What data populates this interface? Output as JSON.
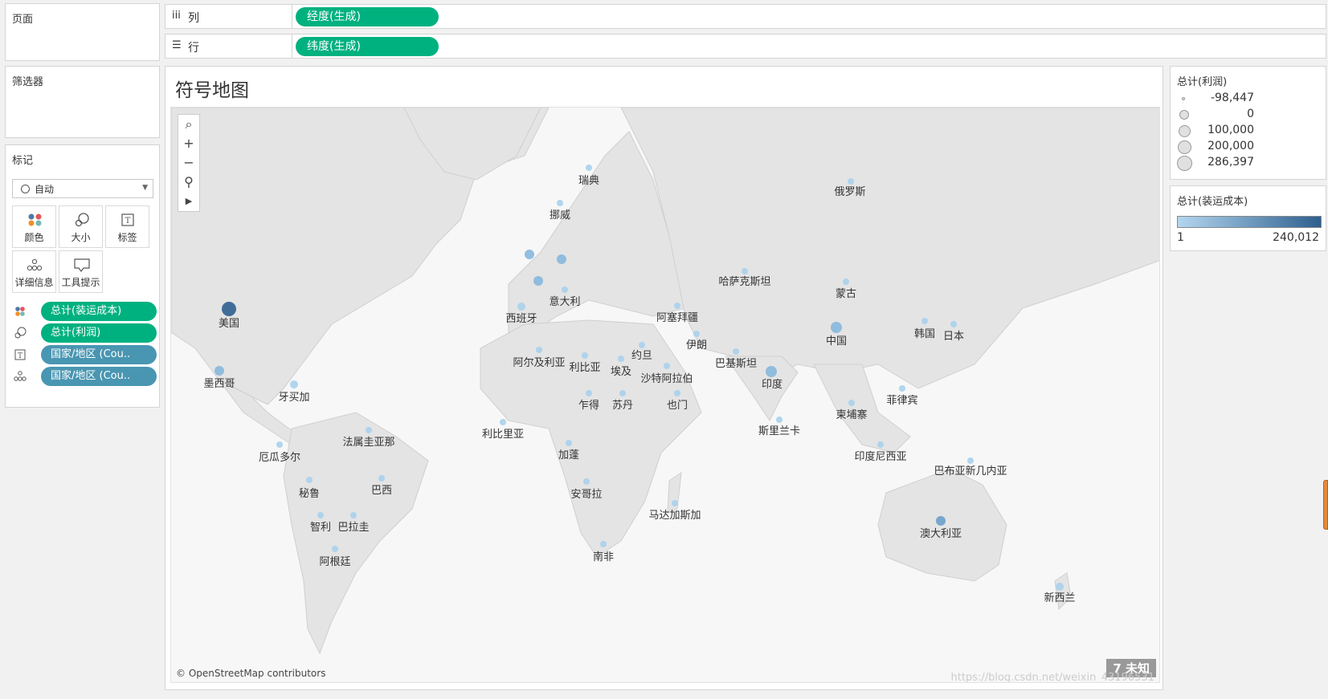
{
  "left": {
    "pages_title": "页面",
    "filters_title": "筛选器",
    "marks_title": "标记",
    "mark_type": "自动",
    "mark_buttons": [
      {
        "label": "颜色",
        "icon": "color-icon"
      },
      {
        "label": "大小",
        "icon": "size-icon"
      },
      {
        "label": "标签",
        "icon": "label-icon"
      },
      {
        "label": "详细信息",
        "icon": "detail-icon"
      },
      {
        "label": "工具提示",
        "icon": "tooltip-icon"
      }
    ],
    "mark_pills": [
      {
        "label": "总计(装运成本)",
        "icon": "color-icon"
      },
      {
        "label": "总计(利润)",
        "icon": "size-icon"
      },
      {
        "label": "国家/地区 (Cou..",
        "icon": "label-icon"
      },
      {
        "label": "国家/地区 (Cou..",
        "icon": "detail-icon"
      }
    ]
  },
  "shelves": {
    "columns_label": "列",
    "columns_pill": "经度(生成)",
    "rows_label": "行",
    "rows_pill": "纬度(生成)"
  },
  "view": {
    "title": "符号地图",
    "attribution": "© OpenStreetMap contributors",
    "unknown_badge": "7 未知",
    "watermark": "https://blog.csdn.net/weixin_43196531"
  },
  "legend_profit": {
    "title": "总计(利润)",
    "items": [
      "-98,447",
      "0",
      "100,000",
      "200,000",
      "286,397"
    ]
  },
  "legend_ship": {
    "title": "总计(装运成本)",
    "min": "1",
    "max": "240,012"
  },
  "map_labels": [
    "瑞典",
    "俄罗斯",
    "挪威",
    "哈萨克斯坦",
    "蒙古",
    "意大利",
    "西班牙",
    "美国",
    "阿塞拜疆",
    "伊朗",
    "中国",
    "韩国",
    "日本",
    "约旦",
    "埃及",
    "阿尔及利亚",
    "利比亚",
    "巴基斯坦",
    "沙特阿拉伯",
    "印度",
    "墨西哥",
    "牙买加",
    "乍得",
    "苏丹",
    "也门",
    "菲律宾",
    "利比里亚",
    "柬埔寨",
    "斯里兰卡",
    "法属圭亚那",
    "加蓬",
    "厄瓜多尔",
    "印度尼西亚",
    "巴布亚新几内亚",
    "巴西",
    "秘鲁",
    "安哥拉",
    "马达加斯加",
    "智利",
    "巴拉圭",
    "澳大利亚",
    "阿根廷",
    "南非",
    "新西兰"
  ]
}
